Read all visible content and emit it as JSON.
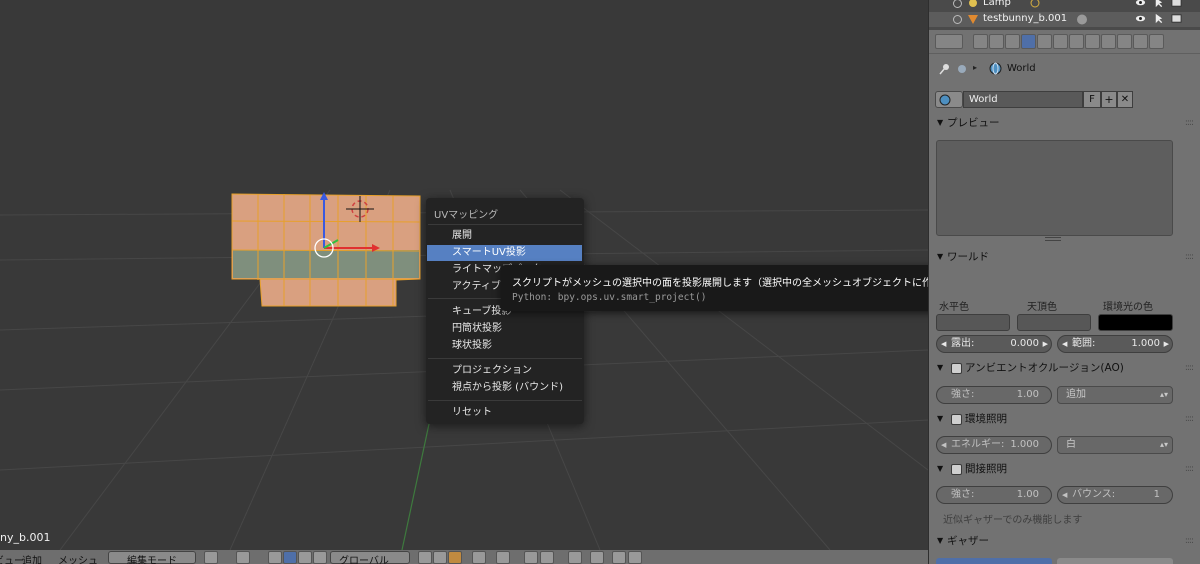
{
  "viewport": {
    "object_name": "ny_b.001"
  },
  "uv_menu": {
    "title": "UVマッピング",
    "items": [
      "展開",
      "スマートUV投影",
      "ライトマップパック",
      "アクティブ四角形に追従",
      "キューブ投影",
      "円筒状投影",
      "球状投影",
      "プロジェクション",
      "視点から投影 (バウンド)",
      "リセット"
    ]
  },
  "tooltip": {
    "description": "スクリプトがメッシュの選択中の面を投影展開します（選択中の全メッシュオブジェクトに作用し、選択中の面またはすべての面の展開に使用できます）",
    "python": "Python: bpy.ops.uv.smart_project()"
  },
  "header": {
    "view": "ビュー",
    "add": "追加",
    "mesh": "メッシュ",
    "mode": "編集モード",
    "orientation": "グローバル"
  },
  "outliner": {
    "rows": [
      "Lamp",
      "testbunny_b.001"
    ]
  },
  "properties": {
    "breadcrumb": "World",
    "world_field": "World",
    "fake_user": "F",
    "preview_panel": "プレビュー",
    "world_panel": "ワールド",
    "color_labels": [
      "水平色",
      "天頂色",
      "環境光の色"
    ],
    "exposure_label": "露出:",
    "exposure_value": "0.000",
    "range_label": "範囲:",
    "range_value": "1.000",
    "ao_panel": "アンビエントオクルージョン(AO)",
    "ao_strength_label": "強さ:",
    "ao_strength_value": "1.00",
    "ao_blend": "追加",
    "env_panel": "環境照明",
    "env_energy_label": "エネルギー:",
    "env_energy_value": "1.000",
    "env_color": "白",
    "indirect_panel": "間接照明",
    "indirect_strength_label": "強さ:",
    "indirect_strength_value": "1.00",
    "indirect_bounce_label": "バウンス:",
    "indirect_bounce_value": "1",
    "indirect_note": "近似ギャザーでのみ機能します",
    "gather_panel": "ギャザー"
  },
  "colors": {
    "menu_highlight": "#5680c2",
    "mesh_face": "#d9a080",
    "mesh_face_selected_band": "#7f8f7d",
    "mesh_edge": "#f0a020",
    "active_tab": "#4f6fa8"
  }
}
